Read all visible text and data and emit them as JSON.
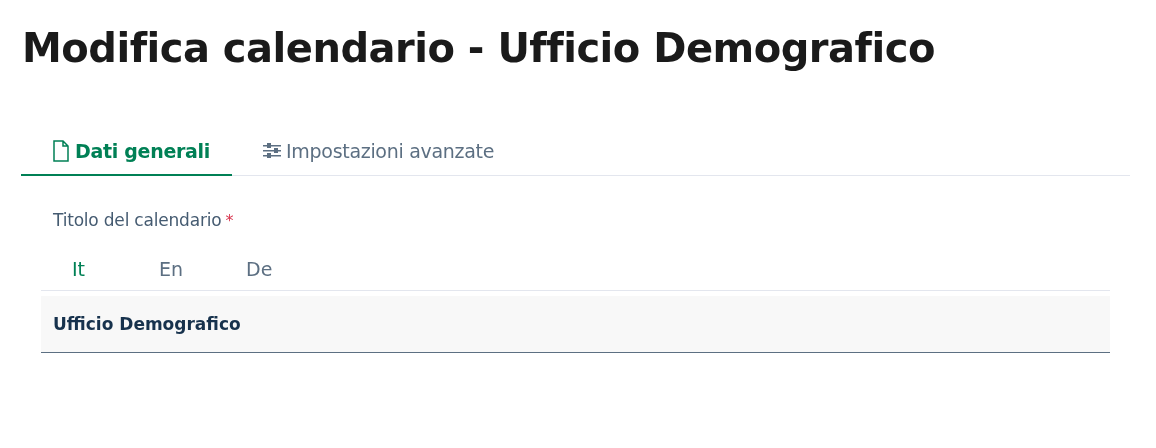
{
  "page_title": "Modifica calendario - Ufficio Demografico",
  "tabs": [
    {
      "label": "Dati generali",
      "kind": "document",
      "selected": true
    },
    {
      "label": "Impostazioni avanzate",
      "kind": "sliders",
      "selected": false
    }
  ],
  "field": {
    "label": "Titolo del calendario",
    "required_mark": "*",
    "languages": [
      {
        "label": "It",
        "selected": true
      },
      {
        "label": "En",
        "selected": false
      },
      {
        "label": "De",
        "selected": false
      }
    ],
    "value": "Ufficio Demografico"
  }
}
